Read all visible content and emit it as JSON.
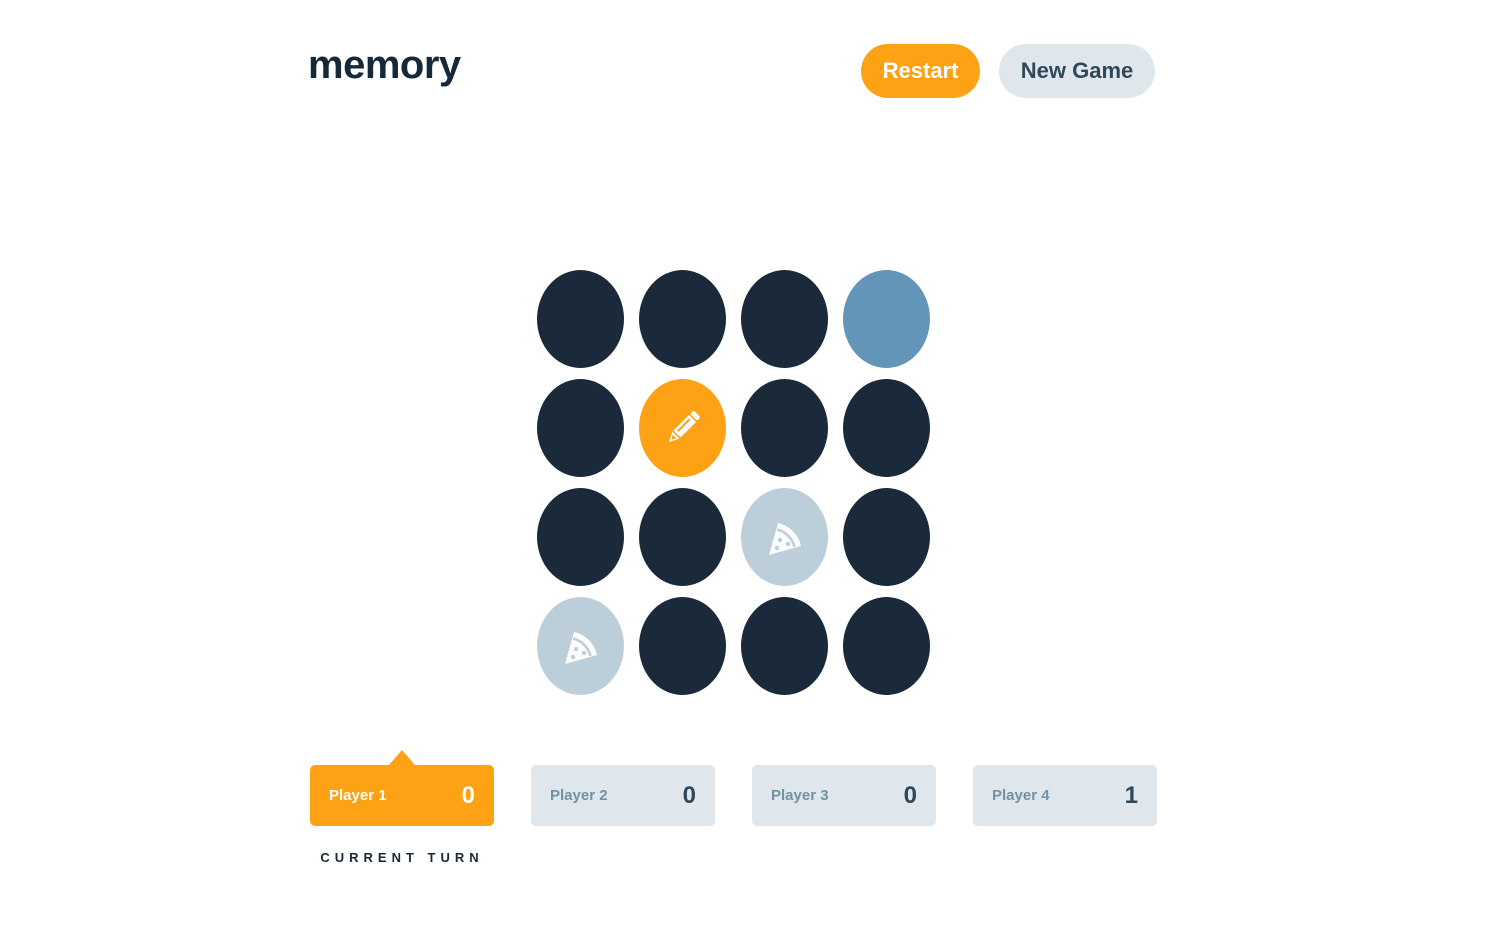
{
  "app": {
    "logo": "memory"
  },
  "header": {
    "restart_label": "Restart",
    "new_game_label": "New Game"
  },
  "colors": {
    "accent": "#FDA214",
    "tile_hidden": "#1A2A3A",
    "tile_hover": "#6395B8",
    "tile_matched": "#BCCED9",
    "panel": "#DFE7EC",
    "text_dark": "#152938"
  },
  "board": {
    "size": "4x4",
    "tiles": [
      {
        "state": "hidden",
        "icon": ""
      },
      {
        "state": "hidden",
        "icon": ""
      },
      {
        "state": "hidden",
        "icon": ""
      },
      {
        "state": "hover",
        "icon": ""
      },
      {
        "state": "hidden",
        "icon": ""
      },
      {
        "state": "active",
        "icon": "pencil-icon"
      },
      {
        "state": "hidden",
        "icon": ""
      },
      {
        "state": "hidden",
        "icon": ""
      },
      {
        "state": "hidden",
        "icon": ""
      },
      {
        "state": "hidden",
        "icon": ""
      },
      {
        "state": "matched",
        "icon": "pizza-slice-icon"
      },
      {
        "state": "hidden",
        "icon": ""
      },
      {
        "state": "matched",
        "icon": "pizza-slice-icon"
      },
      {
        "state": "hidden",
        "icon": ""
      },
      {
        "state": "hidden",
        "icon": ""
      },
      {
        "state": "hidden",
        "icon": ""
      }
    ]
  },
  "players": [
    {
      "name": "Player 1",
      "score": "0",
      "current": true
    },
    {
      "name": "Player 2",
      "score": "0",
      "current": false
    },
    {
      "name": "Player 3",
      "score": "0",
      "current": false
    },
    {
      "name": "Player 4",
      "score": "1",
      "current": false
    }
  ],
  "turn_label": "CURRENT TURN"
}
